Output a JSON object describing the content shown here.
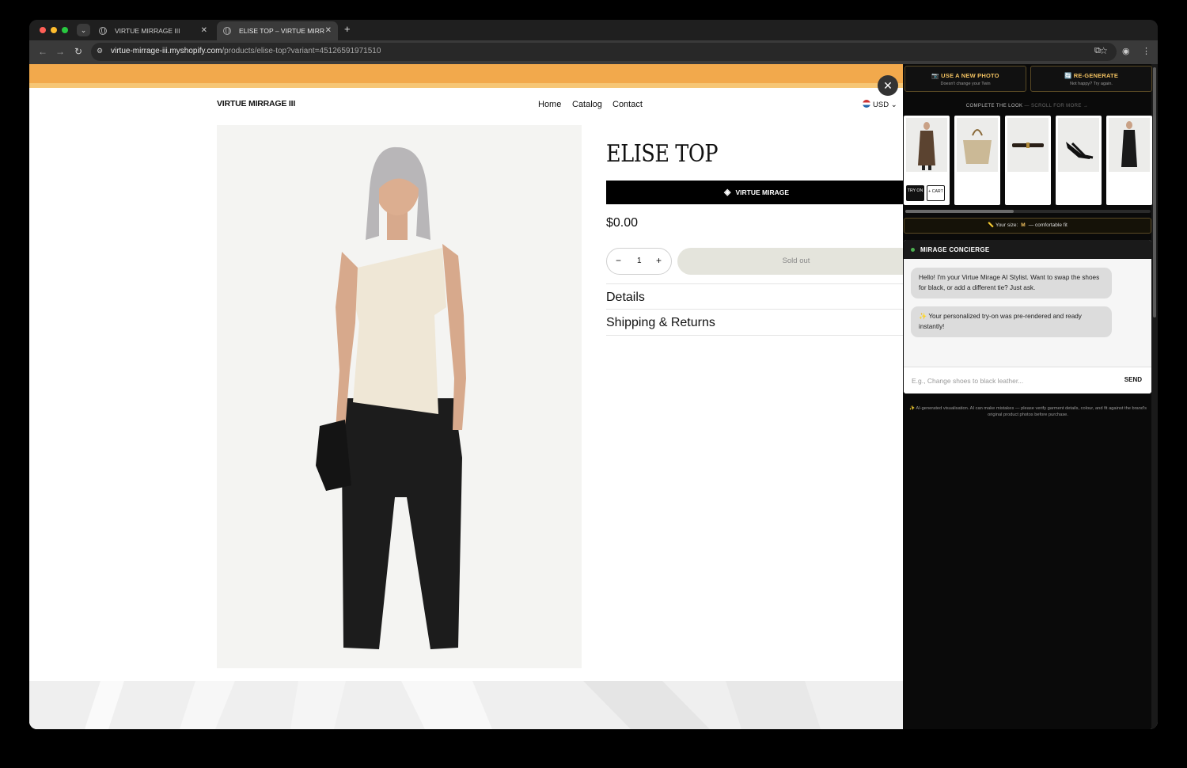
{
  "browser": {
    "tabs": [
      {
        "title": "VIRTUE MIRRAGE III"
      },
      {
        "title": "ELISE TOP – VIRTUE MIRRAGE III"
      }
    ],
    "new_tab": "+",
    "url_host": "virtue-mirrage-iii.myshopify.com",
    "url_path": "/products/elise-top?variant=45126591971510"
  },
  "store": {
    "logo": "VIRTUE MIRRAGE III",
    "nav": [
      "Home",
      "Catalog",
      "Contact"
    ],
    "currency": "USD"
  },
  "product": {
    "title": "ELISE TOP",
    "vm_button": "VIRTUE MIRAGE",
    "price": "$0.00",
    "quantity": "1",
    "sold_out": "Sold out",
    "accordions": [
      "Details",
      "Shipping & Returns"
    ]
  },
  "panel": {
    "use_photo": {
      "title": "📷 USE A NEW PHOTO",
      "sub": "Doesn't change your Twin"
    },
    "regenerate": {
      "title": "🔄 RE-GENERATE",
      "sub": "Not happy? Try again."
    },
    "complete_look": "COMPLETE THE LOOK",
    "scroll_hint": "— SCROLL FOR MORE →",
    "look_items": [
      {
        "name": "brown coat look"
      },
      {
        "name": "woven tote bag"
      },
      {
        "name": "black belt"
      },
      {
        "name": "black heels"
      },
      {
        "name": "black outfit look"
      }
    ],
    "try_on": "TRY ON",
    "add_cart": "+ CART",
    "size_prefix": "📏 Your size:",
    "size_value": "M",
    "size_suffix": "— comfortable fit",
    "chat_title": "MIRAGE CONCIERGE",
    "messages": [
      "Hello! I'm your Virtue Mirage AI Stylist. Want to swap the shoes for black, or add a different tie? Just ask.",
      "✨ Your personalized try-on was pre-rendered and ready instantly!"
    ],
    "input_placeholder": "E.g., Change shoes to black leather...",
    "send": "SEND",
    "disclaimer": "✨ AI-generated visualisation. AI can make mistakes — please verify garment details, colour, and fit against the brand's original product photos before purchase."
  }
}
